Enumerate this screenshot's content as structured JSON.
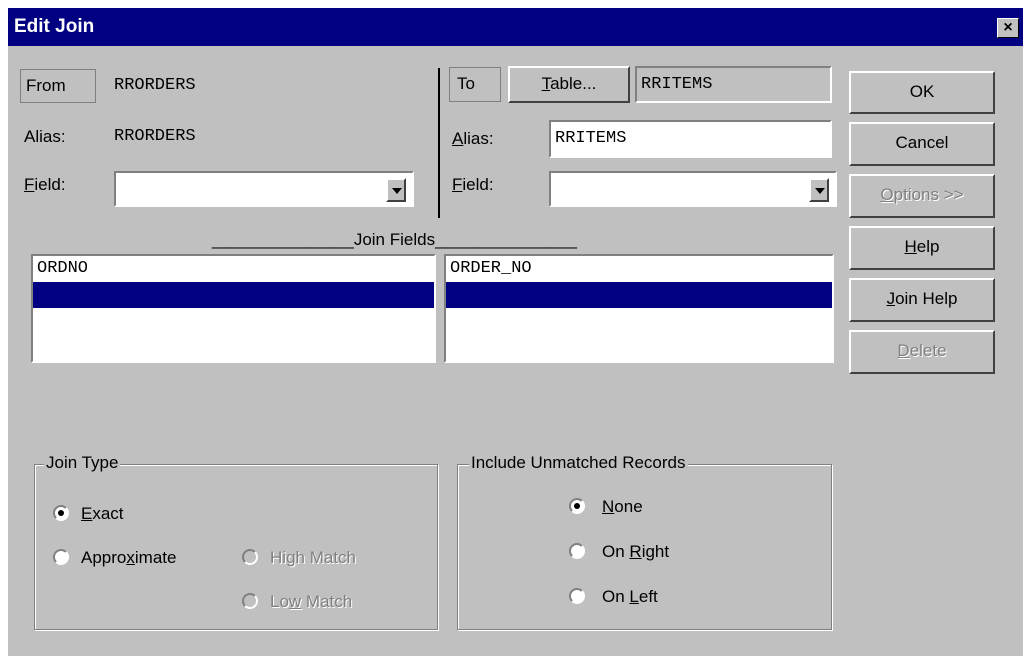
{
  "window": {
    "title": "Edit Join",
    "close_glyph": "×"
  },
  "from": {
    "button_label": "From",
    "table_name": "RRORDERS",
    "alias_label": "Alias:",
    "alias_value": "RRORDERS",
    "field_label": "Field:",
    "field_value": ""
  },
  "to": {
    "button_label": "To",
    "table_button_label": "Table...",
    "table_name": "RRITEMS",
    "alias_label": "Alias:",
    "alias_value": "RRITEMS",
    "field_label": "Field:",
    "field_value": ""
  },
  "join_fields": {
    "heading": "_______________Join Fields_______________",
    "left_rows": [
      "ORDNO",
      ""
    ],
    "right_rows": [
      "ORDER_NO",
      ""
    ]
  },
  "buttons": {
    "ok": "OK",
    "cancel": "Cancel",
    "options": "Options >>",
    "help": "Help",
    "join_help": "Join Help",
    "delete": "Delete"
  },
  "join_type": {
    "title": "Join Type",
    "exact": "Exact",
    "approximate": "Approximate",
    "high_match": "High Match",
    "low_match": "Low Match",
    "selected": "exact"
  },
  "unmatched": {
    "title": "Include Unmatched Records",
    "none": "None",
    "on_right": "On Right",
    "on_left": "On Left",
    "selected": "none"
  },
  "colors": {
    "face": "#c0c0c0",
    "title_bar": "#000080",
    "selection": "#000080"
  }
}
